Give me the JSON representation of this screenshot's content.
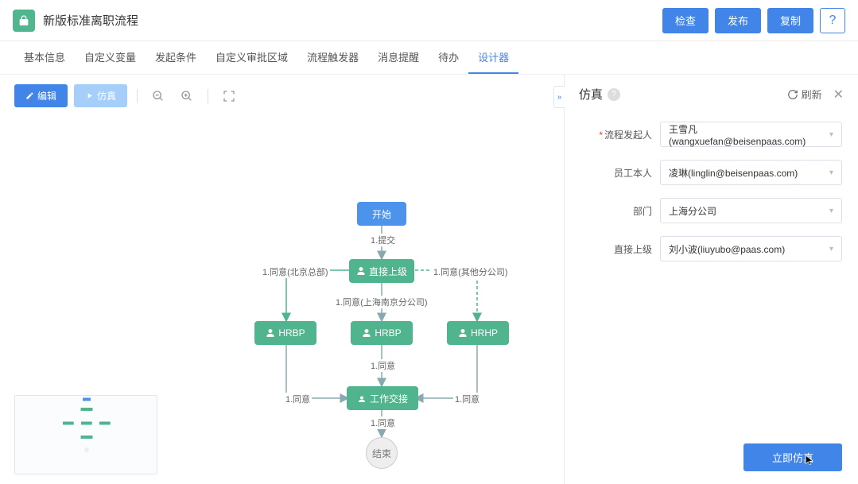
{
  "header": {
    "title": "新版标准离职流程",
    "actions": {
      "check": "检查",
      "publish": "发布",
      "copy": "复制",
      "help": "?"
    }
  },
  "tabs": [
    "基本信息",
    "自定义变量",
    "发起条件",
    "自定义审批区域",
    "流程触发器",
    "消息提醒",
    "待办",
    "设计器"
  ],
  "active_tab_index": 7,
  "toolbar": {
    "edit": "编辑",
    "sim": "仿真"
  },
  "flow": {
    "start": "开始",
    "end": "结束",
    "nodes": {
      "direct_supervisor": "直接上级",
      "hrbp1": "HRBP",
      "hrbp2": "HRBP",
      "hrhp": "HRHP",
      "handover": "工作交接"
    },
    "edges": {
      "submit": "1.提交",
      "agree_bj": "1.同意(北京总部)",
      "agree_other": "1.同意(其他分公司)",
      "agree_shnj": "1.同意(上海南京分公司)",
      "agree1": "1.同意",
      "agree2": "1.同意",
      "agree3": "1.同意",
      "agree4": "1.同意"
    }
  },
  "panel": {
    "title": "仿真",
    "refresh": "刷新",
    "fields": {
      "initiator": {
        "label": "流程发起人",
        "value": "王雪凡(wangxuefan@beisenpaas.com)",
        "required": true
      },
      "employee": {
        "label": "员工本人",
        "value": "凌琳(linglin@beisenpaas.com)"
      },
      "dept": {
        "label": "部门",
        "value": "上海分公司"
      },
      "supervisor": {
        "label": "直接上级",
        "value": "刘小波(liuyubo@paas.com)"
      }
    },
    "run": "立即仿真"
  }
}
